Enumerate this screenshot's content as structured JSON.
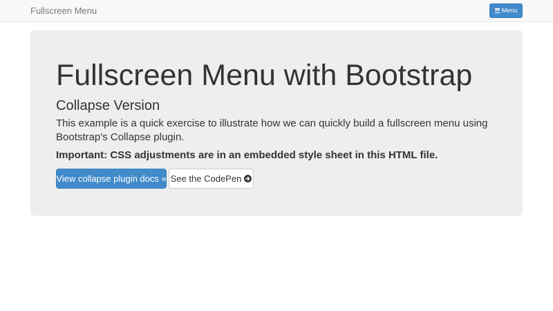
{
  "navbar": {
    "brand": "Fullscreen Menu",
    "menu_button_label": "Menu",
    "menu_icon": "hamburger-icon"
  },
  "jumbotron": {
    "title": "Fullscreen Menu with Bootstrap",
    "subtitle": "Collapse Version",
    "description": "This example is a quick exercise to illustrate how we can quickly build a fullscreen menu using Bootstrap's Collapse plugin.",
    "important": "Important: CSS adjustments are in an embedded style sheet in this HTML file.",
    "primary_button_label": "View collapse plugin docs »",
    "secondary_button_label": "See the CodePen",
    "secondary_button_icon": "arrow-circle-right-icon"
  },
  "colors": {
    "primary": "#428bca",
    "navbar_bg": "#f8f8f8",
    "jumbotron_bg": "#eeeeee",
    "text": "#333333",
    "brand_text": "#777777"
  }
}
